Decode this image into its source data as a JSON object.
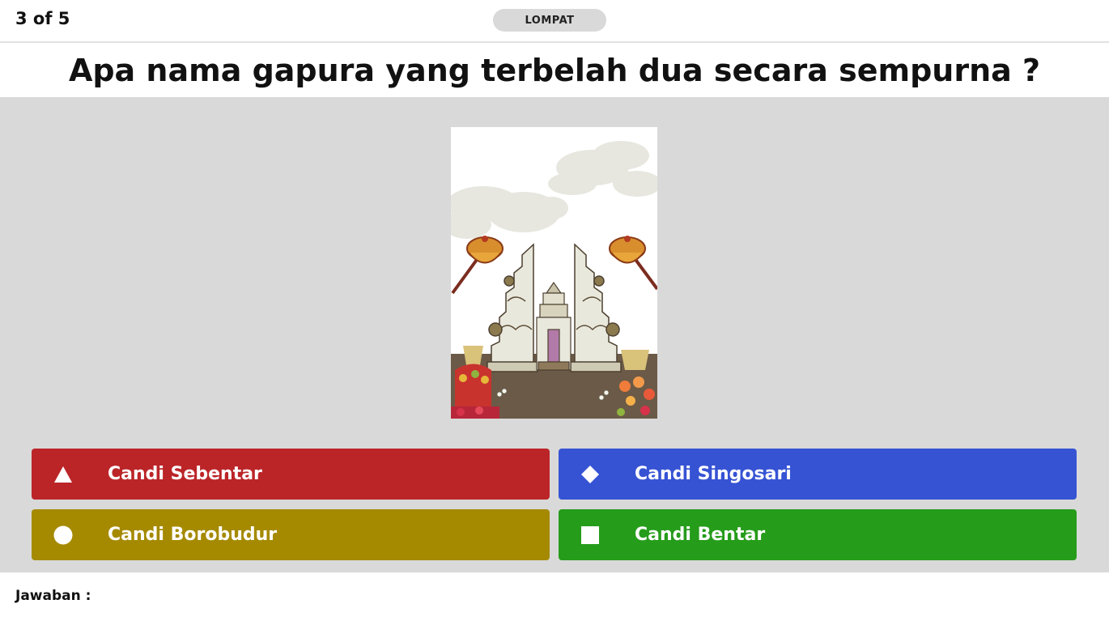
{
  "header": {
    "progress": "3 of 5",
    "skip_label": "LOMPAT"
  },
  "question": {
    "text": "Apa nama gapura yang terbelah dua secara sempurna ?"
  },
  "image": {
    "subject": "Balinese split gate (candi bentar) illustration with ceremonial umbrellas, offerings and flowers"
  },
  "answers": [
    {
      "shape": "triangle-icon",
      "label": "Candi Sebentar",
      "color": "#bb2528"
    },
    {
      "shape": "diamond-icon",
      "label": "Candi Singosari",
      "color": "#3653d4"
    },
    {
      "shape": "circle-icon",
      "label": "Candi Borobudur",
      "color": "#a58a00"
    },
    {
      "shape": "square-icon",
      "label": "Candi Bentar",
      "color": "#269c1b"
    }
  ],
  "footer": {
    "answer_label": "Jawaban :"
  }
}
